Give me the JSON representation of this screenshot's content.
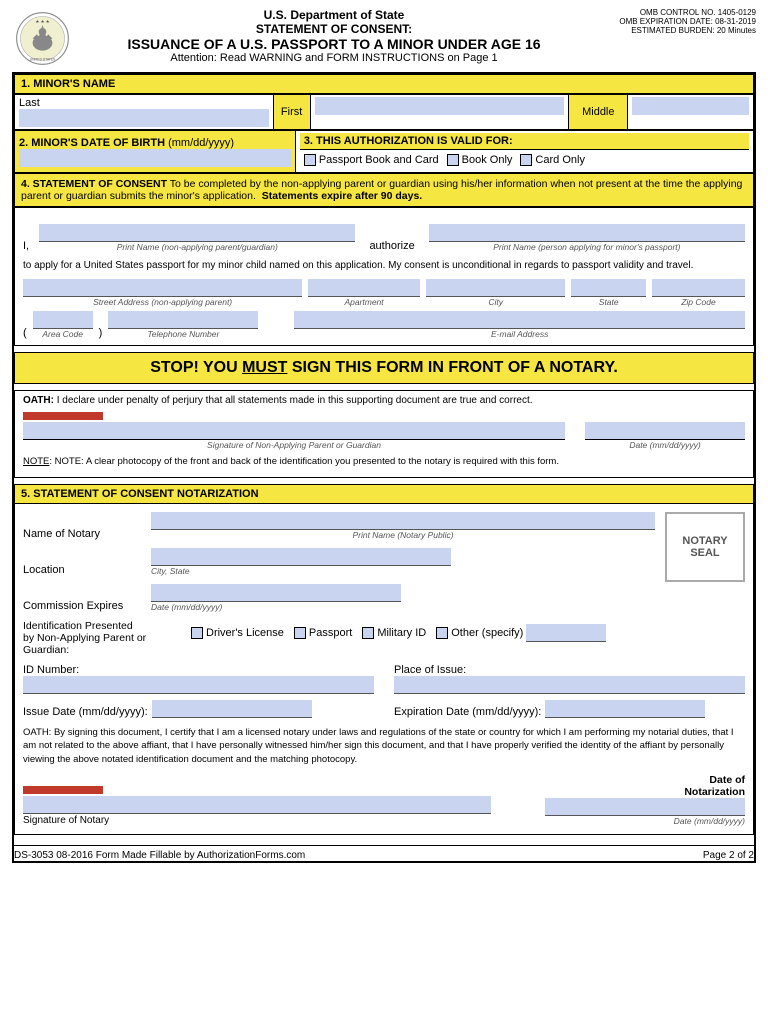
{
  "header": {
    "dept": "U.S. Department of State",
    "title1": "STATEMENT OF CONSENT:",
    "title2": "ISSUANCE OF A U.S. PASSPORT TO A MINOR UNDER AGE 16",
    "title3": "Attention: Read WARNING and FORM INSTRUCTIONS on Page 1",
    "omb1": "OMB CONTROL NO. 1405-0129",
    "omb2": "OMB EXPIRATION DATE: 08-31-2019",
    "omb3": "ESTIMATED BURDEN: 20 Minutes"
  },
  "sections": {
    "s1_label": "1. MINOR'S NAME",
    "last_label": "Last",
    "first_label": "First",
    "middle_label": "Middle",
    "s2_label": "2. MINOR'S DATE OF BIRTH",
    "s2_format": "(mm/dd/yyyy)",
    "s3_label": "3. THIS AUTHORIZATION IS VALID FOR:",
    "passport_book_card": "Passport Book and Card",
    "book_only": "Book Only",
    "card_only": "Card Only",
    "s4_label": "4. STATEMENT OF CONSENT",
    "s4_desc": "To be completed by the non-applying parent or guardian using his/her information when not present at the time the applying parent or guardian submits the minor's application.",
    "s4_expire": "Statements expire after 90 days.",
    "i_label": "I,",
    "authorize_label": "authorize",
    "print_name_1_label": "Print Name (non-applying parent/guardian)",
    "print_name_2_label": "Print Name (person applying for minor's passport)",
    "apply_text": "to apply for a United States passport for my minor child named on this application. My consent is unconditional in regards to passport validity and travel.",
    "street_label": "Street Address (non-applying parent)",
    "apartment_label": "Apartment",
    "city_label": "City",
    "state_label": "State",
    "zip_label": "Zip Code",
    "area_code_label": "Area Code",
    "telephone_label": "Telephone Number",
    "email_label": "E-mail Address",
    "stop_text": "STOP! YOU ",
    "stop_must": "MUST",
    "stop_text2": " SIGN THIS FORM IN FRONT OF A NOTARY.",
    "oath_label": "OATH:",
    "oath_text": "I declare under penalty of perjury that all statements made in this supporting document are true and correct.",
    "signature_label": "Signature of Non-Applying Parent or Guardian",
    "date_label": "Date (mm/dd/yyyy)",
    "note_text": "NOTE: A clear photocopy of the front and back of the identification you presented to the notary is required with this form.",
    "s5_label": "5. STATEMENT OF CONSENT NOTARIZATION",
    "name_of_notary": "Name of Notary",
    "print_name_notary": "Print Name (Notary Public)",
    "location_label": "Location",
    "city_state_label": "City, State",
    "notary_seal": "NOTARY\nSEAL",
    "commission_expires": "Commission Expires",
    "date_format": "Date (mm/dd/yyyy)",
    "id_presented_label": "Identification Presented\nby Non-Applying Parent or\nGuardian:",
    "drivers_license": "Driver's License",
    "passport_id": "Passport",
    "military_id": "Military ID",
    "other_specify": "Other (specify)",
    "id_number_label": "ID Number:",
    "place_of_issue_label": "Place of Issue:",
    "issue_date_label": "Issue Date (mm/dd/yyyy):",
    "expiration_date_label": "Expiration Date (mm/dd/yyyy):",
    "oath_bottom": "OATH: By signing this document, I certify that I am a licensed notary under laws and regulations of the state or country for which I am performing my notarial duties, that I am not related to the above affiant, that I have personally witnessed him/her sign this document, and that I have properly verified the identity of the affiant by personally viewing the above notated identification document and the matching photocopy.",
    "signature_notary": "Signature of Notary",
    "date_of_notarization": "Date of\nNotarization",
    "date_format2": "Date (mm/dd/yyyy)"
  },
  "footer": {
    "form_id": "DS-3053  08-2016  Form Made Fillable by AuthorizationForms.com",
    "page": "Page 2 of 2"
  }
}
